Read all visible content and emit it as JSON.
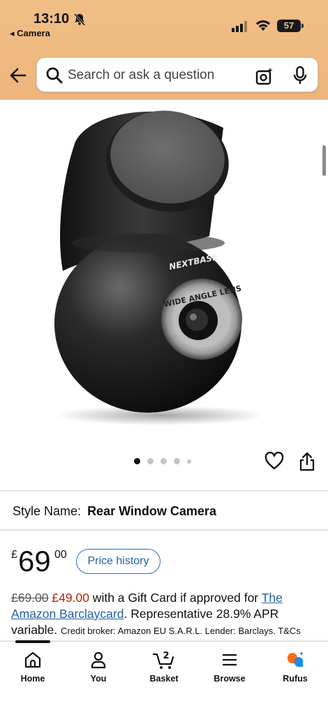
{
  "status_bar": {
    "time": "13:10",
    "back_app": "◂ Camera",
    "battery": "57"
  },
  "search": {
    "placeholder": "Search or ask a question"
  },
  "gallery": {
    "brand_mark": "NEXTBASE",
    "lens_text": "WIDE ANGLE LENS",
    "image_count": 5,
    "active_index": 0
  },
  "style": {
    "label": "Style Name:",
    "value": "Rear Window Camera"
  },
  "price": {
    "currency": "£",
    "whole": "69",
    "fraction": "00",
    "history_button": "Price history"
  },
  "offer": {
    "old_price": "£69.00",
    "new_price": "£49.00",
    "text1": " with a Gift Card if approved for ",
    "link": "The Amazon Barclaycard",
    "text2": ". Representative 28.9% APR variable. ",
    "note": "Credit broker: Amazon EU S.A.R.L. Lender: Barclays. T&Cs"
  },
  "nav": [
    {
      "label": "Home",
      "icon": "home-icon"
    },
    {
      "label": "You",
      "icon": "person-icon"
    },
    {
      "label": "Basket",
      "icon": "cart-icon",
      "badge": "2"
    },
    {
      "label": "Browse",
      "icon": "menu-icon"
    },
    {
      "label": "Rufus",
      "icon": "rufus-icon"
    }
  ],
  "colors": {
    "header": "#f0bf86",
    "link": "#2162a1",
    "deal": "#b12704"
  }
}
